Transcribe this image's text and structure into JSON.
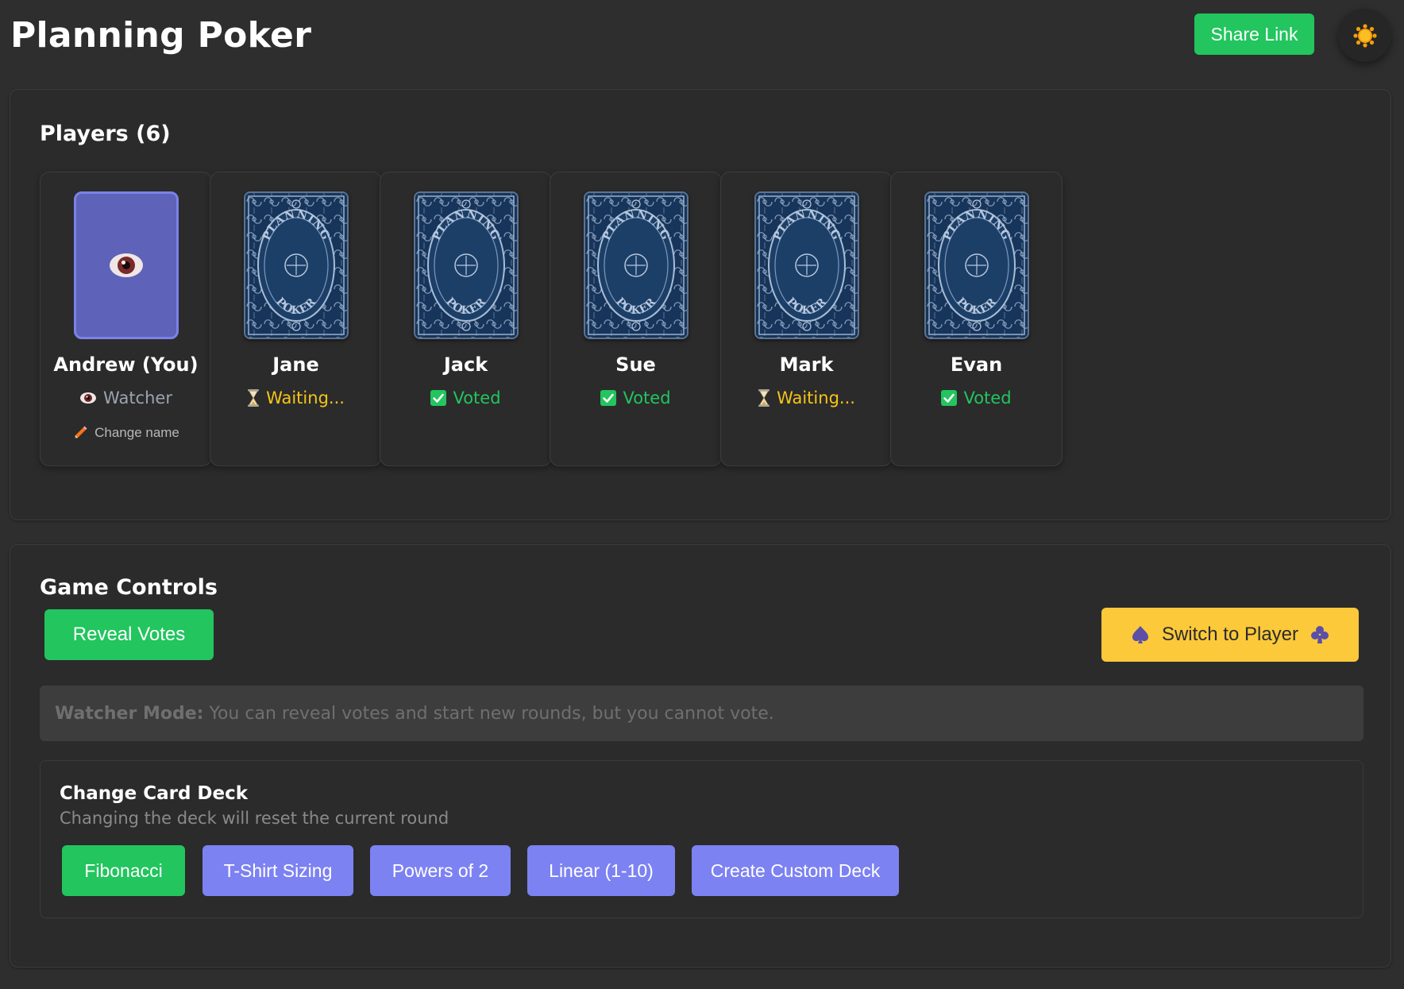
{
  "header": {
    "title": "Planning Poker",
    "share_label": "Share Link",
    "theme_icon": "sun-icon"
  },
  "players": {
    "title": "Players (6)",
    "list": [
      {
        "name": "Andrew (You)",
        "status": "Watcher",
        "status_type": "watcher",
        "card": "watcher",
        "change_name_label": "Change name"
      },
      {
        "name": "Jane",
        "status": "Waiting...",
        "status_type": "waiting",
        "card": "back"
      },
      {
        "name": "Jack",
        "status": "Voted",
        "status_type": "voted",
        "card": "back"
      },
      {
        "name": "Sue",
        "status": "Voted",
        "status_type": "voted",
        "card": "back"
      },
      {
        "name": "Mark",
        "status": "Waiting...",
        "status_type": "waiting",
        "card": "back"
      },
      {
        "name": "Evan",
        "status": "Voted",
        "status_type": "voted",
        "card": "back"
      }
    ],
    "card_back_text": "PLANNING POKER"
  },
  "controls": {
    "title": "Game Controls",
    "reveal_label": "Reveal Votes",
    "switch_label": "Switch to Player",
    "watcher_note_label": "Watcher Mode:",
    "watcher_note_text": "You can reveal votes and start new rounds, but you cannot vote.",
    "deck": {
      "title": "Change Card Deck",
      "subtitle": "Changing the deck will reset the current round",
      "options": [
        {
          "label": "Fibonacci",
          "active": true
        },
        {
          "label": "T-Shirt Sizing",
          "active": false
        },
        {
          "label": "Powers of 2",
          "active": false
        },
        {
          "label": "Linear (1-10)",
          "active": false
        },
        {
          "label": "Create Custom Deck",
          "active": false
        }
      ]
    }
  },
  "colors": {
    "background": "#2e2e2e",
    "panel": "#2b2b2b",
    "green": "#22c55e",
    "yellow": "#fcc93a",
    "purple": "#7c82f2",
    "waiting": "#f5c518",
    "card_back": "#17355a"
  }
}
